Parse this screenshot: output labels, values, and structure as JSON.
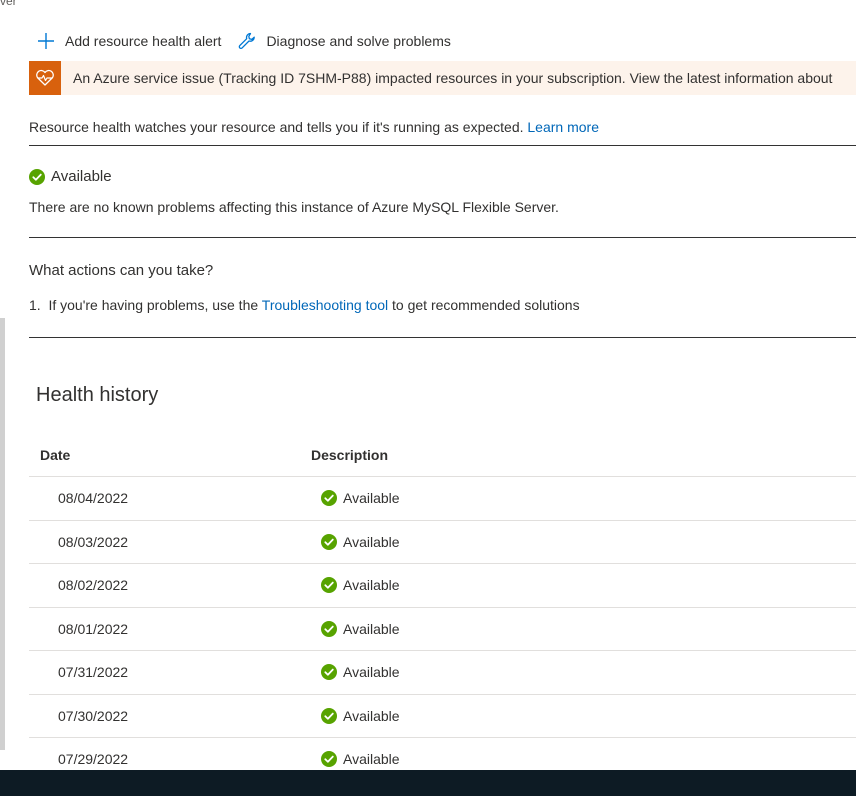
{
  "window": {
    "corner_fragment": "ver"
  },
  "toolbar": {
    "add_alert_label": "Add resource health alert",
    "diagnose_label": "Diagnose and solve problems"
  },
  "banner": {
    "text": "An Azure service issue (Tracking ID 7SHM-P88) impacted resources in your subscription. View the latest information about"
  },
  "intro": {
    "text": "Resource health watches your resource and tells you if it's running as expected. ",
    "learn_more": "Learn more"
  },
  "status": {
    "label": "Available",
    "description": "There are no known problems affecting this instance of Azure MySQL Flexible Server."
  },
  "actions": {
    "heading": "What actions can you take?",
    "item_number": "1.",
    "item_prefix": "If you're having problems, use the ",
    "item_link": "Troubleshooting tool",
    "item_suffix": " to get recommended solutions"
  },
  "history": {
    "title": "Health history",
    "columns": {
      "date": "Date",
      "description": "Description"
    },
    "rows": [
      {
        "date": "08/04/2022",
        "status": "Available"
      },
      {
        "date": "08/03/2022",
        "status": "Available"
      },
      {
        "date": "08/02/2022",
        "status": "Available"
      },
      {
        "date": "08/01/2022",
        "status": "Available"
      },
      {
        "date": "07/31/2022",
        "status": "Available"
      },
      {
        "date": "07/30/2022",
        "status": "Available"
      },
      {
        "date": "07/29/2022",
        "status": "Available"
      }
    ]
  },
  "colors": {
    "accent_link": "#0067b8",
    "status_green": "#57a300",
    "banner_icon_bg": "#d8610d",
    "banner_bg": "#fdf3eb",
    "taskbar": "#0d1b24"
  },
  "icons": {
    "add": "plus-icon",
    "diagnose": "wrench-icon",
    "banner": "service-health-heart-icon",
    "status": "check-circle-icon"
  }
}
